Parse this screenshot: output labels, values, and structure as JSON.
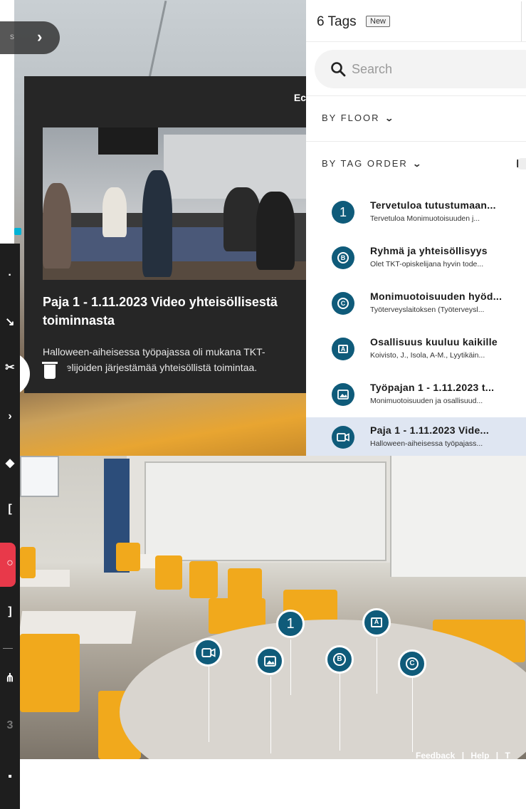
{
  "back_pill": {
    "cut_text": "s"
  },
  "card": {
    "header_cut": "Ec",
    "title_line1": "Paja 1 - 1.11.2023 Video yhteisöllisestä",
    "title_line2": "toiminnasta",
    "description": "Halloween-aiheisessa työpajassa oli mukana TKT-opiskelijoiden järjestämää yhteisöllistä toimintaa.",
    "next_arrow": "›"
  },
  "panel": {
    "title": "6 Tags",
    "badge": "New",
    "search": {
      "placeholder": "Search"
    },
    "by_floor": "BY FLOOR",
    "by_tag_order": "BY TAG ORDER",
    "by_tag_order_cut": "I",
    "tags": [
      {
        "icon": "number-1-icon",
        "glyph": "1",
        "title": "Tervetuloa tutustumaan...",
        "subtitle": "Tervetuloa Monimuotoisuuden j..."
      },
      {
        "icon": "letter-b-icon",
        "glyph": "B",
        "title": "Ryhmä ja yhteisöllisyys",
        "subtitle": "Olet TKT-opiskelijana hyvin tode..."
      },
      {
        "icon": "letter-c-icon",
        "glyph": "C",
        "title": "Monimuotoisuuden hyöd...",
        "subtitle": "Työterveyslaitoksen (Työterveysl..."
      },
      {
        "icon": "letter-a-icon",
        "glyph": "A",
        "title": "Osallisuus kuuluu kaikille",
        "subtitle": "Koivisto, J., Isola, A-M., Lyytikäin..."
      },
      {
        "icon": "image-icon",
        "glyph": "",
        "title": "Työpajan 1 - 1.11.2023 t...",
        "subtitle": "Monimuotoisuuden ja osallisuud..."
      },
      {
        "icon": "video-icon",
        "glyph": "",
        "title": "Paja 1 - 1.11.2023 Vide...",
        "subtitle": "Halloween-aiheisessa työpajass..."
      }
    ]
  },
  "markers": [
    {
      "icon": "number-1-icon",
      "glyph": "1"
    },
    {
      "icon": "letter-a-icon",
      "glyph": "A"
    },
    {
      "icon": "video-icon",
      "glyph": ""
    },
    {
      "icon": "image-icon",
      "glyph": ""
    },
    {
      "icon": "letter-b-icon",
      "glyph": "B"
    },
    {
      "icon": "letter-c-icon",
      "glyph": "C"
    }
  ],
  "footer": {
    "feedback": "Feedback",
    "sep1": "|",
    "help": "Help",
    "sep2": "|",
    "cut": "T"
  },
  "colors": {
    "tag_teal": "#0f5b7a",
    "toolbar": "#1e1e1e",
    "active_tool": "#e8394a",
    "selected_row": "#dfe6f2"
  }
}
